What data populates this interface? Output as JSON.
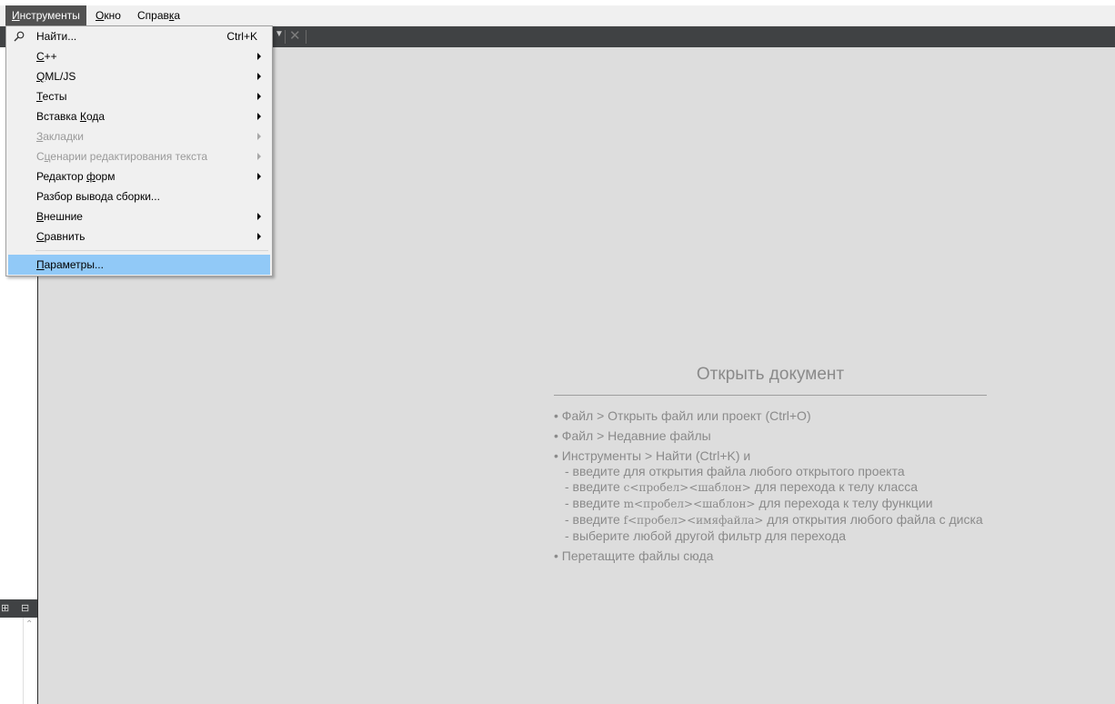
{
  "menubar": {
    "items": [
      {
        "label": "Инструменты",
        "mnemonic": "И",
        "rest": "нструменты",
        "active": true
      },
      {
        "label": "Окно",
        "mnemonic": "О",
        "rest": "кно",
        "active": false
      },
      {
        "label": "Справка",
        "pre": "Справ",
        "mnemonic": "к",
        "rest": "а",
        "active": false
      }
    ]
  },
  "dropdown": {
    "items": [
      {
        "id": "find",
        "label": "Найти...",
        "shortcut": "Ctrl+K",
        "icon": "search-icon",
        "enabled": true
      },
      {
        "id": "cpp",
        "pre": "",
        "mn": "C",
        "post": "++",
        "submenu": true,
        "enabled": true
      },
      {
        "id": "qml",
        "pre": "",
        "mn": "Q",
        "post": "ML/JS",
        "submenu": true,
        "enabled": true
      },
      {
        "id": "tests",
        "pre": "",
        "mn": "Т",
        "post": "есты",
        "submenu": true,
        "enabled": true
      },
      {
        "id": "snippets",
        "pre": "Вставка ",
        "mn": "К",
        "post": "ода",
        "submenu": true,
        "enabled": true
      },
      {
        "id": "bookmarks",
        "pre": "",
        "mn": "З",
        "post": "акладки",
        "submenu": true,
        "enabled": false
      },
      {
        "id": "scripts",
        "pre": "С",
        "mn": "ц",
        "post": "енарии редактирования текста",
        "submenu": true,
        "enabled": false
      },
      {
        "id": "formeditor",
        "pre": "Редактор ",
        "mn": "ф",
        "post": "орм",
        "submenu": true,
        "enabled": true
      },
      {
        "id": "parse",
        "label": "Разбор вывода сборки...",
        "submenu": false,
        "enabled": true
      },
      {
        "id": "external",
        "pre": "",
        "mn": "В",
        "post": "нешние",
        "submenu": true,
        "enabled": true
      },
      {
        "id": "diff",
        "pre": "",
        "mn": "С",
        "post": "равнить",
        "submenu": true,
        "enabled": true
      },
      {
        "id": "options",
        "pre": "",
        "mn": "П",
        "post": "араметры...",
        "submenu": false,
        "enabled": true,
        "highlighted": true
      }
    ]
  },
  "editor": {
    "title": "Открыть документ",
    "bullet": "•",
    "line1": "Файл > Открыть файл или проект (Ctrl+O)",
    "line2": "Файл > Недавние файлы",
    "line3": "Инструменты > Найти (Ctrl+K) и",
    "sub1": "- введите для открытия файла любого открытого проекта",
    "sub2_pre": "- введите ",
    "sub2_code": "c<пробел><шаблон>",
    "sub2_post": " для перехода к телу класса",
    "sub3_pre": "- введите ",
    "sub3_code": "m<пробел><шаблон>",
    "sub3_post": " для перехода к телу функции",
    "sub4_pre": "- введите ",
    "sub4_code": "f<пробел><имяфайла>",
    "sub4_post": " для открытия любого файла с диска",
    "sub5": "- выберите любой другой фильтр для перехода",
    "line4": "Перетащите файлы сюда"
  }
}
